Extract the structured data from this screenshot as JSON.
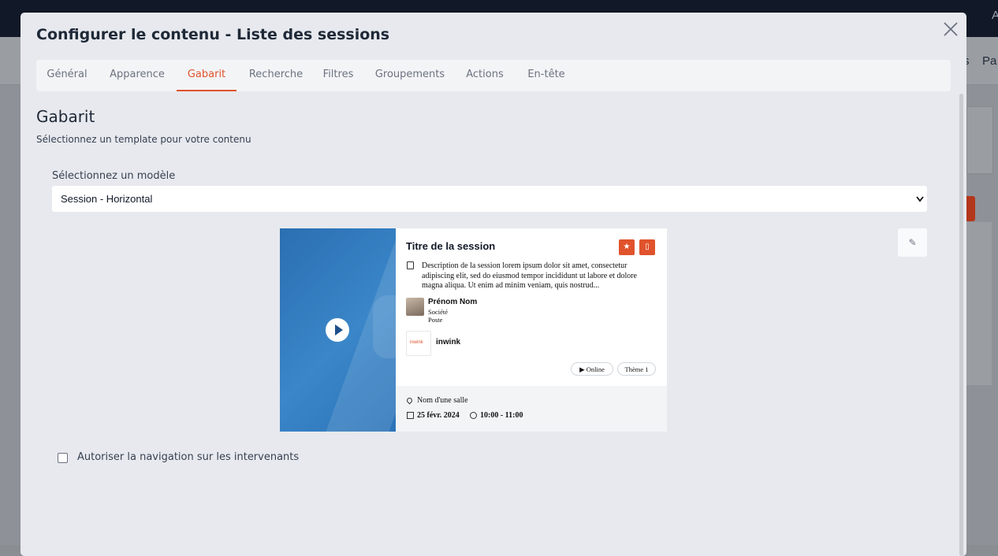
{
  "background": {
    "nav_fragment_1": "s",
    "nav_fragment_2": "Pa",
    "top_fragment": "A"
  },
  "modal": {
    "title": "Configurer le contenu - Liste des sessions",
    "close_icon": "close-icon",
    "tabs": [
      {
        "label": "Général"
      },
      {
        "label": "Apparence"
      },
      {
        "label": "Gabarit"
      },
      {
        "label": "Recherche"
      },
      {
        "label": "Filtres"
      },
      {
        "label": "Groupements"
      },
      {
        "label": "Actions"
      },
      {
        "label": "En-tête"
      }
    ],
    "active_tab": "Gabarit",
    "accent_color": "#e0532c"
  },
  "gabarit": {
    "title": "Gabarit",
    "subtitle": "Sélectionnez un template pour votre contenu",
    "select_label": "Sélectionnez un modèle",
    "select_value": "Session - Horizontal"
  },
  "preview": {
    "title": "Titre de la session",
    "description": "Description de la session lorem ipsum dolor sit amet, consectetur adipiscing elit, sed do eiusmod tempor incididunt ut labore et dolore magna aliqua. Ut enim ad minim veniam, quis nostrud...",
    "speaker": {
      "name": "Prénom Nom",
      "company": "Société",
      "position": "Poste"
    },
    "partner_logo": "inwink",
    "partner_name": "inwink",
    "tags": [
      "Online",
      "Thème 1"
    ],
    "room": "Nom d'une salle",
    "date": "25 févr. 2024",
    "time": "10:00 - 11:00"
  },
  "options": {
    "allow_speaker_nav_label": "Autoriser la navigation sur les intervenants",
    "allow_speaker_nav_checked": false
  }
}
